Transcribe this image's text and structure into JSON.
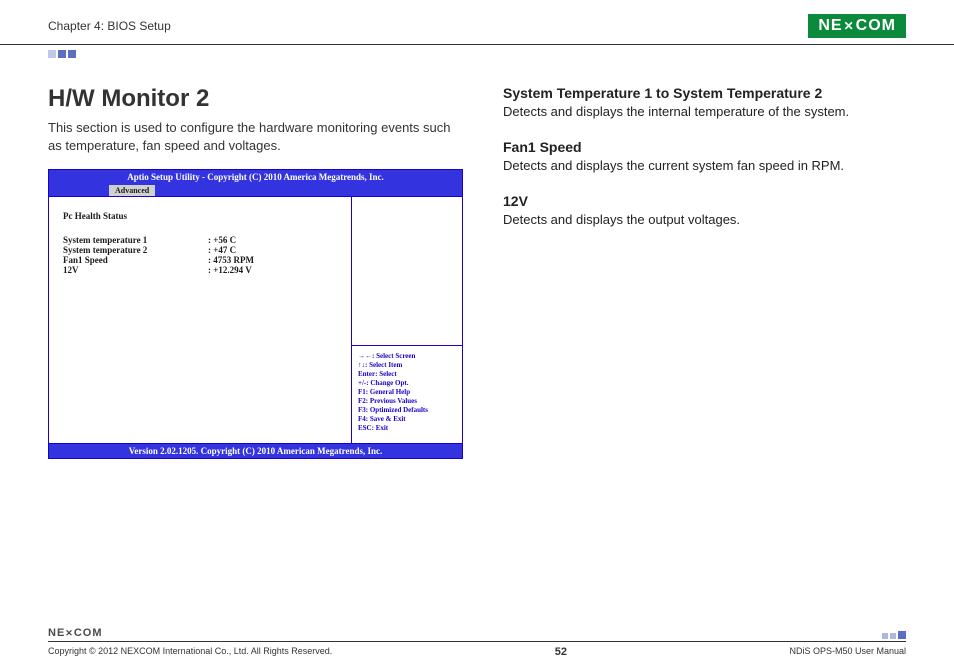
{
  "header": {
    "chapter": "Chapter 4: BIOS Setup",
    "brand": "NE COM"
  },
  "title": "H/W Monitor 2",
  "intro": "This section is used to configure the hardware monitoring events such as temperature, fan speed and voltages.",
  "bios": {
    "top": "Aptio Setup Utility - Copyright (C) 2010 America Megatrends, Inc.",
    "tab": "Advanced",
    "pch": "Pc Health Status",
    "rows": [
      {
        "label": "System temperature 1",
        "value": ": +56 C"
      },
      {
        "label": "System temperature 2",
        "value": ": +47 C"
      },
      {
        "label": "Fan1 Speed",
        "value": ": 4753 RPM"
      },
      {
        "label": "12V",
        "value": ": +12.294 V"
      }
    ],
    "help": [
      "→←: Select Screen",
      "↑↓: Select Item",
      "Enter: Select",
      "+/-: Change Opt.",
      "F1: General Help",
      "F2: Previous Values",
      "F3: Optimized Defaults",
      "F4: Save & Exit",
      "ESC: Exit"
    ],
    "bottom": "Version 2.02.1205. Copyright (C) 2010 American Megatrends, Inc."
  },
  "sections": [
    {
      "h": "System Temperature 1 to System Temperature 2",
      "p": "Detects and displays the internal temperature of the system."
    },
    {
      "h": "Fan1 Speed",
      "p": "Detects and displays the current system fan speed in RPM."
    },
    {
      "h": "12V",
      "p": "Detects and displays the output voltages."
    }
  ],
  "footer": {
    "brand": "NE COM",
    "copyright": "Copyright © 2012 NEXCOM International Co., Ltd. All Rights Reserved.",
    "page": "52",
    "manual": "NDiS OPS-M50 User Manual"
  }
}
